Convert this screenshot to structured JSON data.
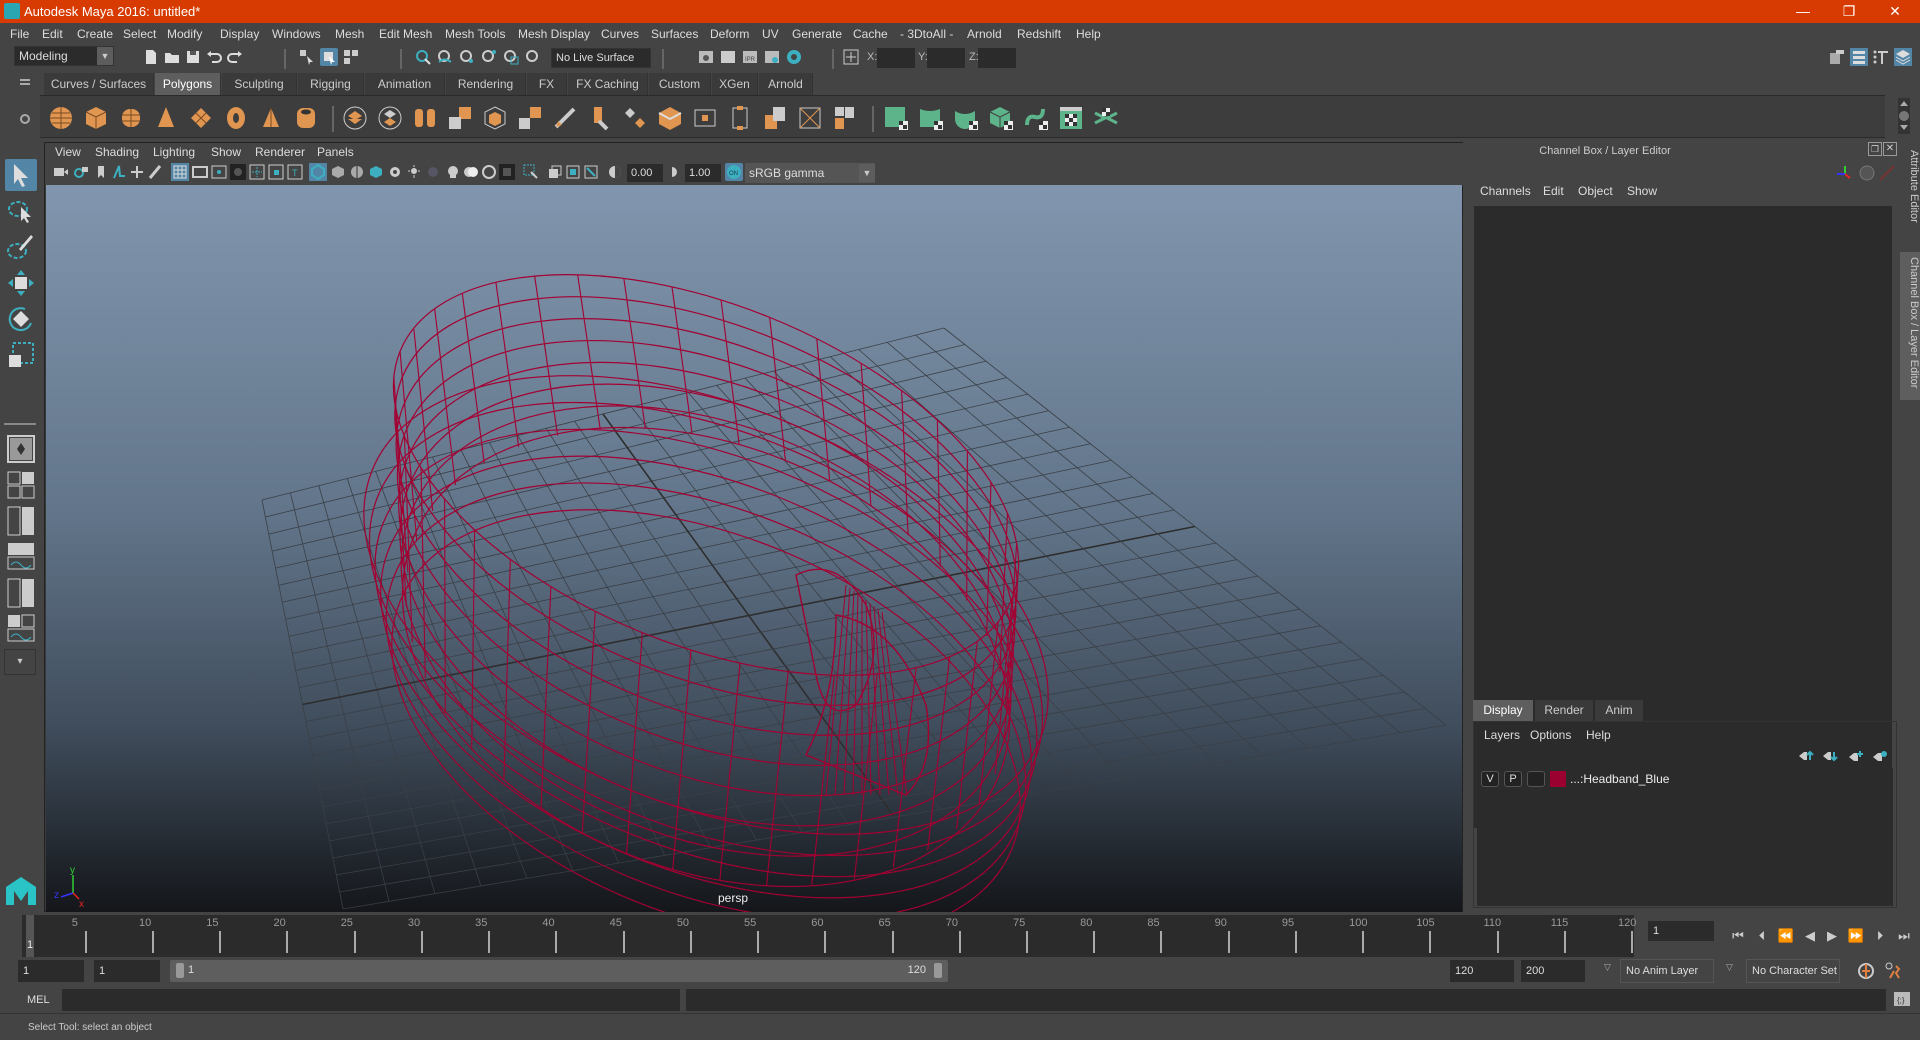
{
  "window": {
    "title": "Autodesk Maya 2016: untitled*",
    "controls": {
      "minimize": "—",
      "restore": "❐",
      "close": "✕"
    }
  },
  "menubar": {
    "items": [
      "File",
      "Edit",
      "Create",
      "Select",
      "Modify",
      "Display",
      "Windows",
      "Mesh",
      "Edit Mesh",
      "Mesh Tools",
      "Mesh Display",
      "Curves",
      "Surfaces",
      "Deform",
      "UV",
      "Generate",
      "Cache",
      "- 3DtoAll -",
      "Arnold",
      "Redshift",
      "Help"
    ]
  },
  "statusline": {
    "mode": "Modeling",
    "live_surface": "No Live Surface",
    "x_label": "X:",
    "y_label": "Y:",
    "z_label": "Z:",
    "x_value": "",
    "y_value": "",
    "z_value": ""
  },
  "shelf": {
    "tabs": [
      "Curves / Surfaces",
      "Polygons",
      "Sculpting",
      "Rigging",
      "Animation",
      "Rendering",
      "FX",
      "FX Caching",
      "Custom",
      "XGen",
      "Arnold"
    ],
    "active_tab": "Polygons",
    "icons": [
      "poly-sphere",
      "poly-cube",
      "poly-cylinder",
      "poly-cone",
      "poly-plane",
      "poly-torus",
      "poly-pyramid",
      "poly-pipe",
      "combine",
      "separate",
      "extract",
      "boolean",
      "smooth",
      "reduce",
      "mirror",
      "multi-cut",
      "extrude",
      "bridge",
      "bevel",
      "append",
      "split",
      "merge",
      "target-weld",
      "uv-planar",
      "uv-cylindrical",
      "uv-spherical",
      "uv-auto",
      "uv-unfold",
      "uv-editor",
      "uv-cut-sew"
    ]
  },
  "viewport": {
    "menus": [
      "View",
      "Shading",
      "Lighting",
      "Show",
      "Renderer",
      "Panels"
    ],
    "exposure": "0.00",
    "gamma": "1.00",
    "color_space": "sRGB gamma",
    "camera_label": "persp",
    "wire_color": "#a30032",
    "axis": {
      "x": "x",
      "y": "y",
      "z": "z"
    }
  },
  "channel_box": {
    "title": "Channel Box / Layer Editor",
    "menus": [
      "Channels",
      "Edit",
      "Object",
      "Show"
    ]
  },
  "layer_editor": {
    "tabs": [
      "Display",
      "Render",
      "Anim"
    ],
    "active_tab": "Display",
    "menus": [
      "Layers",
      "Options",
      "Help"
    ],
    "layers": [
      {
        "visible": "V",
        "playback": "P",
        "color": "#9a0030",
        "name": "...:Headband_Blue"
      }
    ]
  },
  "side_tabs": [
    "Attribute Editor",
    "Channel Box / Layer Editor"
  ],
  "timeline": {
    "current_frame_marker": "1",
    "tick_labels": [
      "5",
      "10",
      "15",
      "20",
      "25",
      "30",
      "35",
      "40",
      "45",
      "50",
      "55",
      "60",
      "65",
      "70",
      "75",
      "80",
      "85",
      "90",
      "95",
      "100",
      "105",
      "110",
      "115",
      "120"
    ],
    "current_frame": "1"
  },
  "range": {
    "start": "1",
    "playback_start": "1",
    "slider_start": "1",
    "slider_end": "120",
    "playback_end": "120",
    "end": "200",
    "anim_layer": "No Anim Layer",
    "character_set": "No Character Set"
  },
  "command_line": {
    "label": "MEL",
    "value": ""
  },
  "help_line": "Select Tool: select an object"
}
